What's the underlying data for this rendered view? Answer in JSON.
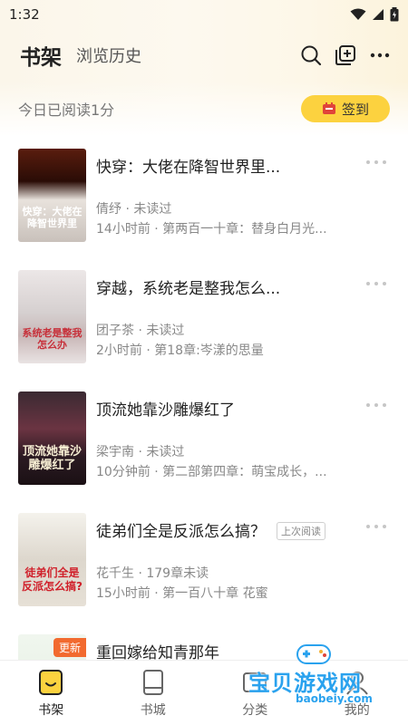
{
  "status_bar": {
    "time": "1:32"
  },
  "header": {
    "tab_active": "书架",
    "tab_other": "浏览历史"
  },
  "reading": {
    "today_text": "今日已阅读1分",
    "checkin_label": "签到"
  },
  "books": [
    {
      "title": "快穿：大佬在降智世界里...",
      "author_status": "倩纾 · 未读过",
      "progress": "14小时前 · 第两百一十章：替身白月光...",
      "cover_text": "快穿：大佬在降智世界里"
    },
    {
      "title": "穿越，系统老是整我怎么...",
      "author_status": "团子茶 · 未读过",
      "progress": "2小时前 · 第18章:岑漾的思量",
      "cover_text": "系统老是整我怎么办"
    },
    {
      "title": "顶流她靠沙雕爆红了",
      "author_status": "梁宇南 · 未读过",
      "progress": "10分钟前 · 第二部第四章：萌宝成长，...",
      "cover_text": "顶流她靠沙雕爆红了"
    },
    {
      "title": "徒弟们全是反派怎么搞？",
      "tag": "上次阅读",
      "author_status": "花千生 · 179章未读",
      "progress": "15小时前 · 第一百八十章 花蜜",
      "cover_text": "徒弟们全是反派怎么搞?"
    },
    {
      "title": "重回嫁给知青那年",
      "badge": "更新"
    }
  ],
  "bottom_nav": [
    {
      "label": "书架",
      "icon": "bookshelf-icon"
    },
    {
      "label": "书城",
      "icon": "book-icon"
    },
    {
      "label": "分类",
      "icon": "category-icon"
    },
    {
      "label": "我的",
      "icon": "profile-icon"
    }
  ],
  "watermark": {
    "text": "宝贝游戏网",
    "url": "baobeiy.com"
  },
  "colors": {
    "accent": "#fcd23f",
    "text_primary": "#222222",
    "text_secondary": "#888888",
    "watermark": "#2aa2ee"
  }
}
